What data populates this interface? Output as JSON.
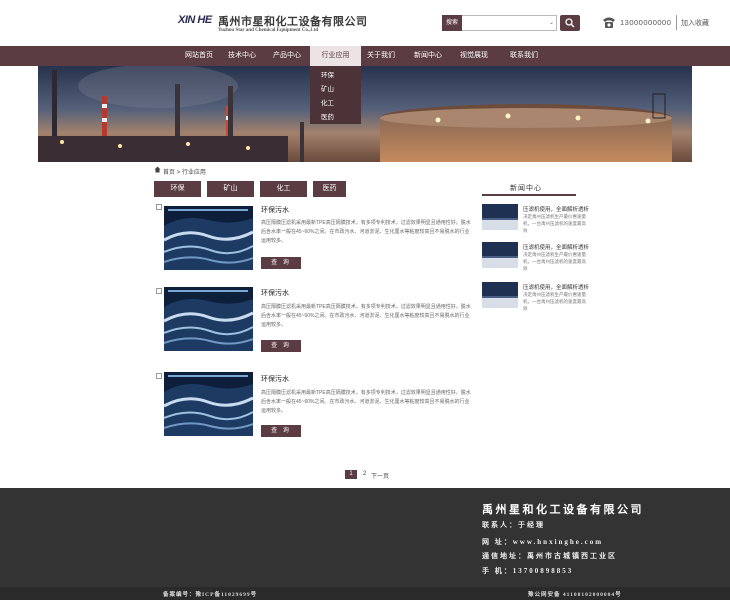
{
  "header": {
    "logo_en": "XIN HE",
    "company_cn": "禹州市星和化工设备有限公司",
    "company_en": "Yuzhou Star and Chemical Equipment Co.,Ltd",
    "search_tag": "搜索",
    "phone": "13000000000",
    "favorite": "加入收藏"
  },
  "nav": {
    "items": [
      "网站首页",
      "技术中心",
      "产品中心",
      "行业应用",
      "关于我们",
      "新闻中心",
      "视觉展现",
      "联系我们"
    ],
    "active": "行业应用"
  },
  "dropdown": [
    "环保",
    "矿山",
    "化工",
    "医药"
  ],
  "breadcrumb": "首页 > 行业应用",
  "categories": [
    "环保",
    "矿山",
    "化工",
    "医药"
  ],
  "products": [
    {
      "title": "环保污水",
      "desc": "高压隔膜压滤机采用最新TPE高压隔膜技术，有多项专利技术，过滤效果明显且通用性好。脱水后含水率一般在45~60%之间。在市政污水、河道淤泥、生化厘水等粘度较高且不易脱水的行业运用较多。",
      "button": "查 询"
    },
    {
      "title": "环保污水",
      "desc": "高压隔膜压滤机采用最新TPE高压隔膜技术，有多项专利技术，过滤效果明显且通用性好。脱水后含水率一般在45~60%之间。在市政污水、河道淤泥、生化厘水等粘度较高且不易脱水的行业运用较多。",
      "button": "查 询"
    },
    {
      "title": "环保污水",
      "desc": "高压隔膜压滤机采用最新TPE高压隔膜技术，有多项专利技术，过滤效果明显且通用性好。脱水后含水率一般在45~60%之间。在市政污水、河道淤泥、生化厘水等粘度较高且不易脱水的行业运用较多。",
      "button": "查 询"
    }
  ],
  "news": {
    "heading": "新闻中心",
    "items": [
      {
        "title": "压滤机使用，全面解析透析",
        "summary": "决定禹州压滤机生产最价惠速量机，一台禹州压滤机的速度最高效"
      },
      {
        "title": "压滤机使用，全面解析透析",
        "summary": "决定禹州压滤机生产最价惠速量机，一台禹州压滤机的速度最高效"
      },
      {
        "title": "压滤机使用，全面解析透析",
        "summary": "决定禹州压滤机生产最价惠速量机，一台禹州压滤机的速度最高效"
      }
    ]
  },
  "pagination": {
    "current": "1",
    "next_page": "2",
    "next_label": "下一页"
  },
  "footer": {
    "company": "禹州星和化工设备有限公司",
    "contact": "联系人：于经理",
    "website": "网 址：www.hnxinghe.com",
    "address": "通信地址：禹州市古城镇西工业区",
    "mobile": "手 机：13700898853",
    "icp": "备案编号：豫ICP备11029699号",
    "police": "豫公网安备 41108102000004号"
  },
  "colors": {
    "brand": "#5a3c42",
    "footer": "#333333"
  }
}
